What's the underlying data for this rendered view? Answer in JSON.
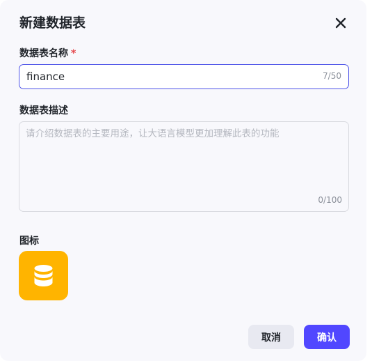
{
  "dialog": {
    "title": "新建数据表",
    "close_icon": "close-icon"
  },
  "name_field": {
    "label": "数据表名称",
    "required_mark": "*",
    "value": "finance",
    "counter": "7/50"
  },
  "description_field": {
    "label": "数据表描述",
    "placeholder": "请介绍数据表的主要用途，让大语言模型更加理解此表的功能",
    "value": "",
    "counter": "0/100"
  },
  "icon_section": {
    "label": "图标",
    "icon": "database-icon",
    "tile_color": "#ffb400"
  },
  "footer": {
    "cancel_label": "取消",
    "confirm_label": "确认",
    "accent_color": "#5147ff"
  }
}
